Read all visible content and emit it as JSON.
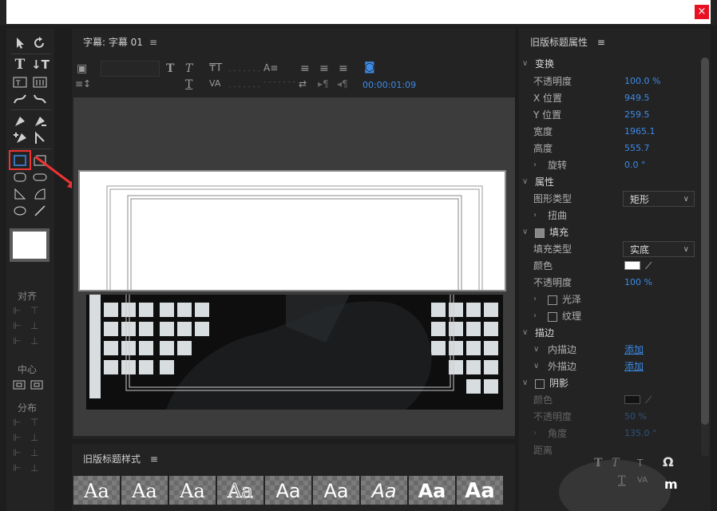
{
  "window": {
    "close_label": "×"
  },
  "tools_panel": {
    "align_label": "对齐",
    "center_label": "中心",
    "distribute_label": "分布"
  },
  "editor": {
    "tab_title": "字幕: 字幕 01",
    "menu_glyph": "≡",
    "timecode": "00:00:01:09"
  },
  "properties": {
    "title": "旧版标题属性",
    "menu_glyph": "≡",
    "transform": {
      "label": "变换",
      "opacity_label": "不透明度",
      "opacity": "100.0 %",
      "x_label": "X 位置",
      "x": "949.5",
      "y_label": "Y 位置",
      "y": "259.5",
      "width_label": "宽度",
      "width": "1965.1",
      "height_label": "高度",
      "height": "555.7",
      "rotation_label": "旋转",
      "rotation": "0.0 °"
    },
    "attributes": {
      "label": "属性",
      "shape_type_label": "图形类型",
      "shape_type": "矩形",
      "distort_label": "扭曲"
    },
    "fill": {
      "label": "填充",
      "checked": true,
      "fill_type_label": "填充类型",
      "fill_type": "实底",
      "color_label": "颜色",
      "color": "#ffffff",
      "opacity_label": "不透明度",
      "opacity": "100 %",
      "sheen_label": "光泽",
      "texture_label": "纹理"
    },
    "stroke": {
      "label": "描边",
      "inner_label": "内描边",
      "inner_action": "添加",
      "outer_label": "外描边",
      "outer_action": "添加"
    },
    "shadow": {
      "label": "阴影",
      "checked": false,
      "color_label": "颜色",
      "color": "#000000",
      "opacity_label": "不透明度",
      "opacity": "50 %",
      "angle_label": "角度",
      "angle": "135.0 °",
      "distance_label": "距离"
    }
  },
  "styles_panel": {
    "title": "旧版标题样式",
    "menu_glyph": "≡",
    "items": [
      "Aa",
      "Aa",
      "Aa",
      "Aa",
      "Aa",
      "Aa",
      "Aa",
      "Aa",
      "Aa"
    ]
  },
  "colors": {
    "accent": "#3c8ce8",
    "highlight": "#e33333"
  }
}
